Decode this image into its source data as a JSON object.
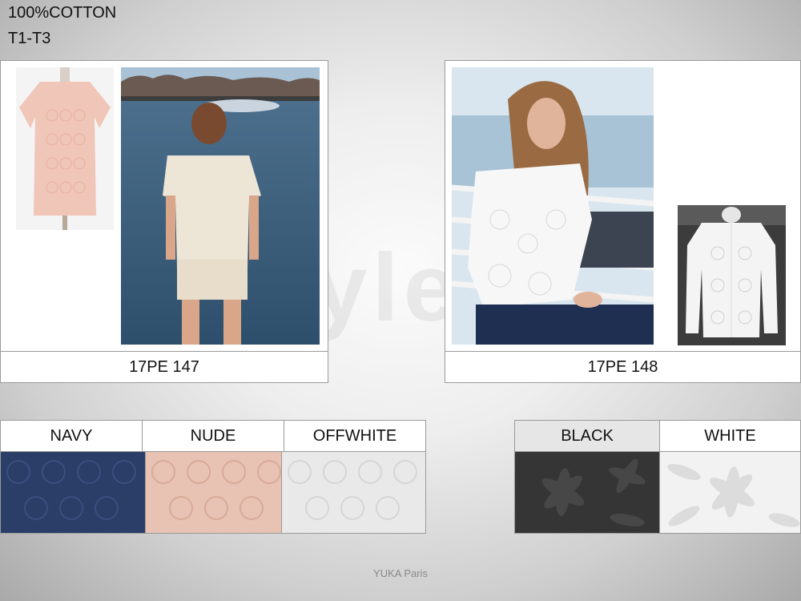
{
  "header": {
    "composition": "100%COTTON",
    "size_range": "T1-T3"
  },
  "products": [
    {
      "code": "17PE 147"
    },
    {
      "code": "17PE 148"
    }
  ],
  "colors_left": [
    {
      "name": "NAVY",
      "hex": "#2b3e68"
    },
    {
      "name": "NUDE",
      "hex": "#e8c2b3"
    },
    {
      "name": "OFFWHITE",
      "hex": "#e9e9e9"
    }
  ],
  "colors_right": [
    {
      "name": "BLACK",
      "hex": "#353535"
    },
    {
      "name": "WHITE",
      "hex": "#f2f2f2"
    }
  ],
  "footer": {
    "brand": "YUKA Paris"
  }
}
